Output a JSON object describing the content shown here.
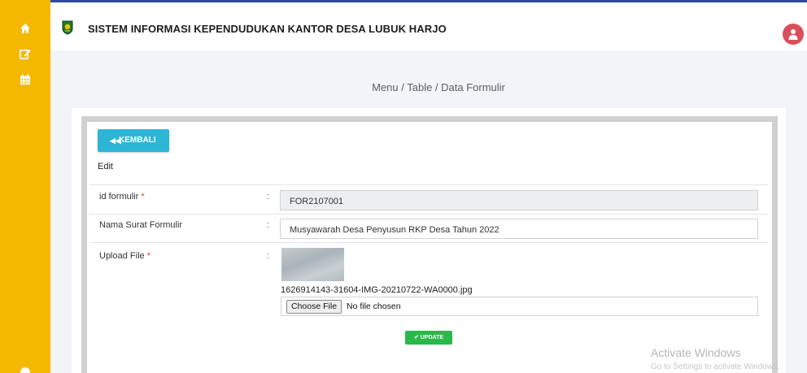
{
  "app": {
    "title": "SISTEM INFORMASI KEPENDUDUKAN KANTOR DESA LUBUK HARJO"
  },
  "sidebar": {
    "icons": [
      "home-icon",
      "edit-icon",
      "calendar-icon",
      "globe-icon"
    ]
  },
  "breadcrumb": "Menu / Table / Data Formulir",
  "form": {
    "back_label": "KEMBALI",
    "section_label": "Edit",
    "colon": ":",
    "fields": {
      "id": {
        "label": "id formulir",
        "required": "*",
        "value": "FOR2107001"
      },
      "nama": {
        "label": "Nama Surat Formulir",
        "value": "Musyawarah Desa Penyusun RKP Desa Tahun 2022"
      },
      "upload": {
        "label": "Upload File",
        "required": "*",
        "filename": "1626914143-31604-IMG-20210722-WA0000.jpg",
        "choose_label": "Choose File",
        "no_file": "No file chosen"
      }
    },
    "update_label": "UPDATE"
  },
  "watermark": {
    "title": "Activate Windows",
    "subtitle": "Go to Settings to activate Windows."
  },
  "colors": {
    "sidebar": "#f5b800",
    "back_button": "#2cb6d6",
    "update_button": "#28b94a",
    "avatar": "#d94e5a",
    "header_border": "#2f4a9c"
  }
}
